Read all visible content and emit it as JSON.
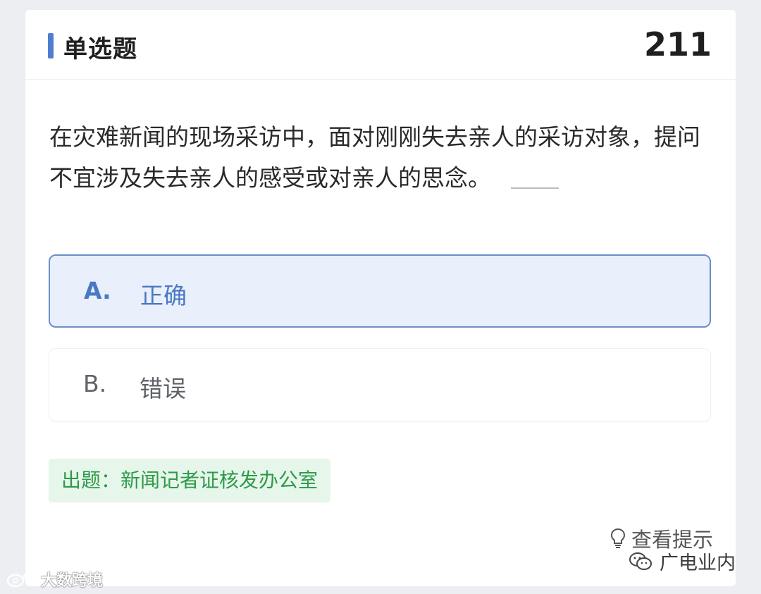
{
  "header": {
    "type_label": "单选题",
    "question_number": "211"
  },
  "question": {
    "stem": "在灾难新闻的现场采访中，面对刚刚失去亲人的采访对象，提问不宜涉及失去亲人的感受或对亲人的思念。"
  },
  "options": [
    {
      "letter": "A.",
      "text": "正确",
      "selected": true
    },
    {
      "letter": "B.",
      "text": "错误",
      "selected": false
    }
  ],
  "source": {
    "label": "出题：新闻记者证核发办公室"
  },
  "hint": {
    "label": "查看提示",
    "icon": "lightbulb-icon"
  },
  "watermarks": {
    "wechat_account": "广电业内",
    "wechat_icon": "wechat-icon",
    "left_brand": "大数跨境",
    "left_icon": "weibo-icon"
  },
  "colors": {
    "accent": "#4a78c2",
    "selected_bg": "#e9f0fc",
    "selected_border": "#6b8fc9",
    "source_bg": "#e6f6ea",
    "source_text": "#2f9a4a",
    "bar": "#4f7ed0"
  }
}
